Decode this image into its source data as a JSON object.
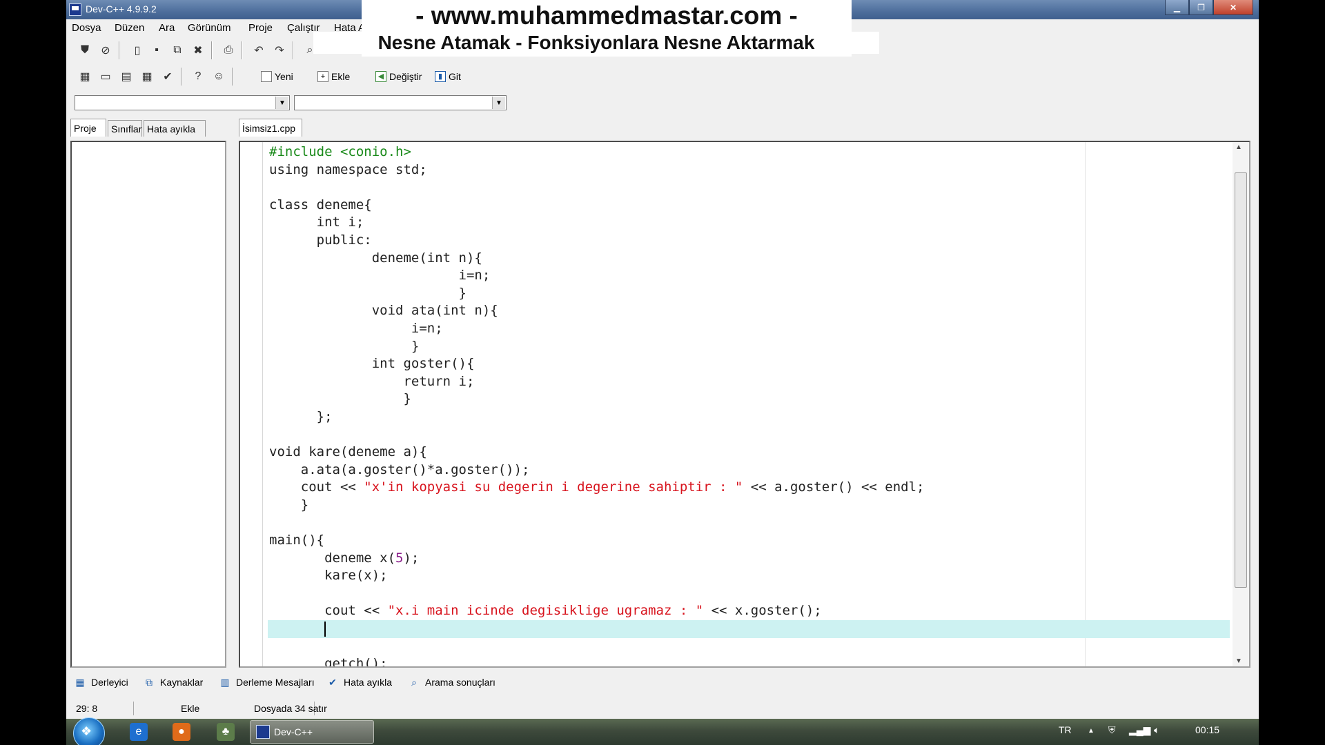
{
  "window": {
    "title": "Dev-C++ 4.9.9.2",
    "min_glyph": "▁",
    "max_glyph": "❐",
    "close_glyph": "✕"
  },
  "overlay": {
    "line1": "- www.muhammedmastar.com -",
    "line2": "Nesne Atamak - Fonksiyonlara Nesne Aktarmak"
  },
  "menu": [
    "Dosya",
    "Düzen",
    "Ara",
    "Görünüm",
    "Proje",
    "Çalıştır",
    "Hata Ayıklama",
    "A"
  ],
  "toolbar": {
    "new_label": "Yeni",
    "add_label": "Ekle",
    "change_label": "Değiştir",
    "goto_label": "Git"
  },
  "left_tabs": [
    "Proje",
    "Sınıflar",
    "Hata ayıkla"
  ],
  "file_tab": "İsimsiz1.cpp",
  "code_lines": [
    [
      {
        "t": "#include <conio.h>",
        "c": "pp"
      }
    ],
    [
      {
        "t": "using namespace std;"
      }
    ],
    [
      {
        "t": ""
      }
    ],
    [
      {
        "t": "class deneme{"
      }
    ],
    [
      {
        "t": "      int i;"
      }
    ],
    [
      {
        "t": "      public:"
      }
    ],
    [
      {
        "t": "             deneme(int n){"
      }
    ],
    [
      {
        "t": "                        i=n;"
      }
    ],
    [
      {
        "t": "                        }"
      }
    ],
    [
      {
        "t": "             void ata(int n){"
      }
    ],
    [
      {
        "t": "                  i=n;"
      }
    ],
    [
      {
        "t": "                  }"
      }
    ],
    [
      {
        "t": "             int goster(){"
      }
    ],
    [
      {
        "t": "                 return i;"
      }
    ],
    [
      {
        "t": "                 }"
      }
    ],
    [
      {
        "t": "      };"
      }
    ],
    [
      {
        "t": ""
      }
    ],
    [
      {
        "t": "void kare(deneme a){"
      }
    ],
    [
      {
        "t": "    a.ata(a.goster()*a.goster());"
      }
    ],
    [
      {
        "t": "    cout << "
      },
      {
        "t": "\"x'in kopyasi su degerin i degerine sahiptir : \"",
        "c": "str"
      },
      {
        "t": " << a.goster() << endl;"
      }
    ],
    [
      {
        "t": "    }"
      }
    ],
    [
      {
        "t": ""
      }
    ],
    [
      {
        "t": "main(){"
      }
    ],
    [
      {
        "t": "       deneme x("
      },
      {
        "t": "5",
        "c": "num"
      },
      {
        "t": ");"
      }
    ],
    [
      {
        "t": "       kare(x);"
      }
    ],
    [
      {
        "t": ""
      }
    ],
    [
      {
        "t": "       cout << "
      },
      {
        "t": "\"x.i main icinde degisiklige ugramaz : \"",
        "c": "str"
      },
      {
        "t": " << x.goster();"
      }
    ],
    [
      {
        "t": "       "
      }
    ],
    [
      {
        "t": ""
      }
    ],
    [
      {
        "t": "       getch();"
      }
    ]
  ],
  "bottom_tabs": [
    "Derleyici",
    "Kaynaklar",
    "Derleme Mesajları",
    "Hata ayıkla",
    "Arama sonuçları"
  ],
  "status": {
    "position": "29: 8",
    "mode": "Ekle",
    "info": "Dosyada 34 satır"
  },
  "taskbar": {
    "task_label": "Dev-C++",
    "lang": "TR",
    "clock": "00:15"
  }
}
